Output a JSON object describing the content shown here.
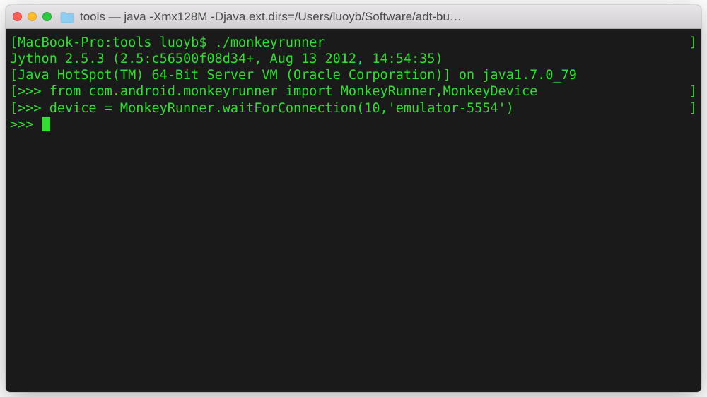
{
  "titlebar": {
    "title": "tools — java -Xmx128M -Djava.ext.dirs=/Users/luoyb/Software/adt-bu…"
  },
  "terminal": {
    "lines": [
      {
        "left_bracket": "[",
        "text": "MacBook-Pro:tools luoyb$ ./monkeyrunner",
        "right_bracket": "]"
      },
      {
        "left_bracket": "",
        "text": "Jython 2.5.3 (2.5:c56500f08d34+, Aug 13 2012, 14:54:35)",
        "right_bracket": ""
      },
      {
        "left_bracket": "",
        "text": "[Java HotSpot(TM) 64-Bit Server VM (Oracle Corporation)] on java1.7.0_79",
        "right_bracket": ""
      },
      {
        "left_bracket": "[",
        "text": ">>> from com.android.monkeyrunner import MonkeyRunner,MonkeyDevice",
        "right_bracket": "]"
      },
      {
        "left_bracket": "[",
        "text": ">>> device = MonkeyRunner.waitForConnection(10,'emulator-5554')",
        "right_bracket": "]"
      }
    ],
    "prompt": ">>> "
  }
}
